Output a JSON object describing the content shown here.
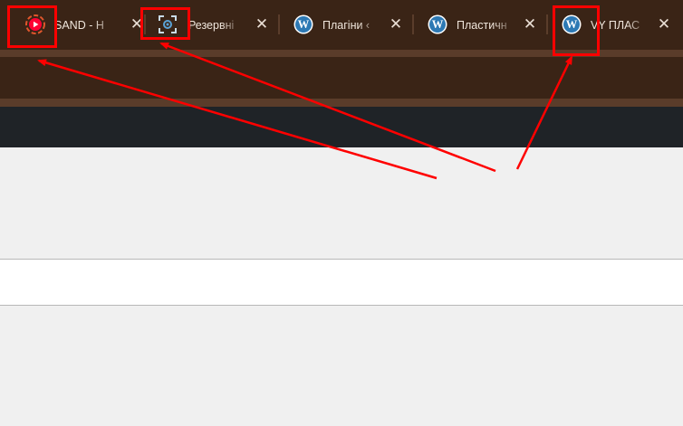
{
  "tabs": [
    {
      "title": "SAND - H",
      "icon": "youtube-icon",
      "close": "✕"
    },
    {
      "title": "Резервні",
      "icon": "screenshot-capture-icon",
      "close": "✕"
    },
    {
      "title": "Плагіни ‹",
      "icon": "wordpress-icon",
      "close": "✕"
    },
    {
      "title": "Пластичн",
      "icon": "wordpress-icon",
      "close": "✕"
    },
    {
      "title": "VY ПЛАС",
      "icon": "wordpress-icon",
      "close": "✕"
    }
  ],
  "colors": {
    "tabbar": "#3a2416",
    "tab_text": "#f0e6dc",
    "adminbar": "#1f2327",
    "content": "#f0f0f0",
    "annotation": "#ff0000",
    "youtube_red": "#ff0033",
    "wordpress_blue": "#2d79b4"
  }
}
